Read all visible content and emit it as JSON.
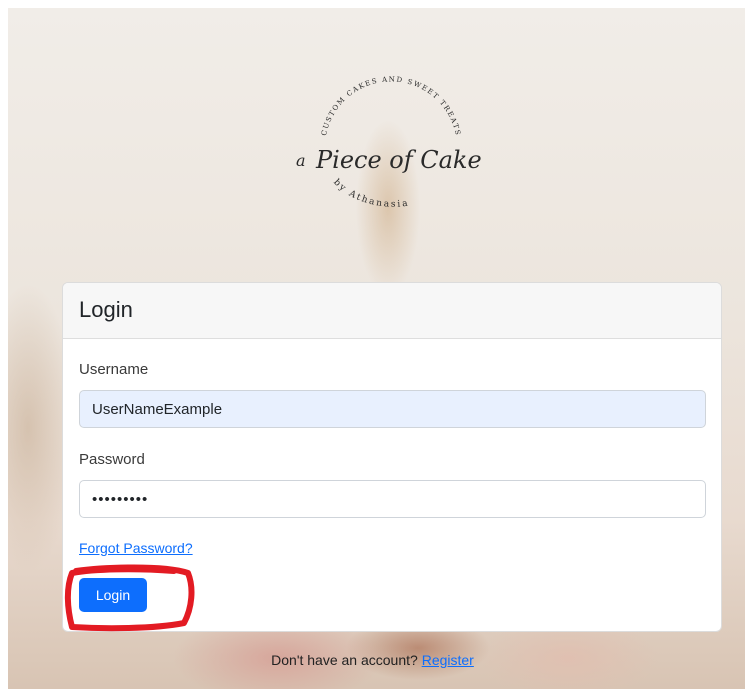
{
  "logo": {
    "arc_top_text": "CUSTOM CAKES AND SWEET TREATS",
    "script_a": "a",
    "script_name": "Piece of Cake",
    "arc_bottom_text": "by Athanasia"
  },
  "login_card": {
    "title": "Login",
    "username_label": "Username",
    "username_value": "UserNameExample",
    "password_label": "Password",
    "password_value": "•••••••••",
    "forgot_password_link": "Forgot Password?",
    "login_button": "Login"
  },
  "footer": {
    "prompt": "Don't have an account? ",
    "register_link": "Register"
  },
  "colors": {
    "primary": "#0d6efd",
    "annotation_red": "#e31b23",
    "autofill_bg": "#e8f0fe"
  },
  "icons": [
    "brand-logo-icon"
  ]
}
